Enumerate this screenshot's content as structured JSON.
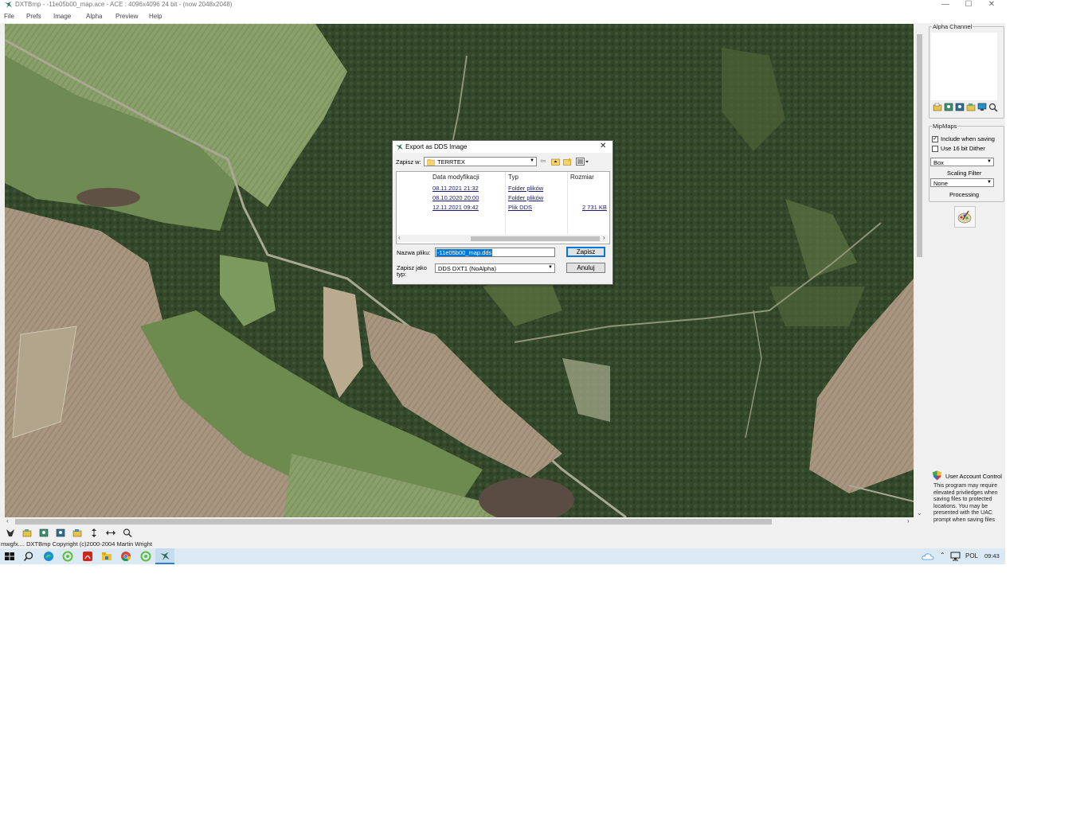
{
  "window": {
    "title": "DXTBmp - -11e05b00_map.ace - ACE : 4096x4096 24 bit - (now 2048x2048)",
    "min_glyph": "—",
    "max_glyph": "☐",
    "close_glyph": "✕"
  },
  "menu": [
    "File",
    "Prefs",
    "Image",
    "Alpha",
    "Preview",
    "Help"
  ],
  "right_panel": {
    "alpha_channel_label": "Alpha Channel",
    "mipmaps_label": "MipMaps",
    "include_when_saving": "Include when saving",
    "include_checked_glyph": "✓",
    "use_16bit_dither": "Use 16 bit Dither",
    "filter_value": "Box",
    "scaling_filter_label": "Scaling Filter",
    "processing_value": "None",
    "processing_label": "Processing",
    "uac_title": "User Account Control",
    "uac_text": "This program may require elevated priviledges when saving files to protected locations. You may be presented with the UAC prompt when saving files"
  },
  "statusbar": {
    "text": "mwgfx.... DXTBmp Copyright (c)2000-2004 Martin Wright"
  },
  "dialog": {
    "title": "Export as DDS Image",
    "close_glyph": "✕",
    "save_in_label": "Zapisz w:",
    "save_in_value": "TERRTEX",
    "columns": [
      "Data modyfikacji",
      "Typ",
      "Rozmiar"
    ],
    "files": [
      {
        "date": "08.11.2021 21:32",
        "type": "Folder plików",
        "size": ""
      },
      {
        "date": "08.10.2020 20:00",
        "type": "Folder plików",
        "size": ""
      },
      {
        "date": "12.11.2021 09:42",
        "type": "Plik DDS",
        "size": "2 731 KB"
      }
    ],
    "filename_label": "Nazwa pliku:",
    "filename_value": "-11e05b00_map.dds",
    "savetype_label_1": "Zapisz jako",
    "savetype_label_2": "typ:",
    "savetype_value": "DDS DXT1 (NoAlpha)",
    "save_button": "Zapisz",
    "cancel_button": "Anuluj"
  },
  "taskbar": {
    "language": "POL",
    "time": "09:43"
  },
  "icons": {
    "app": "dxtbmp-app-icon",
    "search": "search-icon",
    "edge": "edge-browser-icon",
    "chrome": "chrome-icon",
    "acrobat": "pdf-reader-icon",
    "explorer": "file-explorer-icon"
  }
}
